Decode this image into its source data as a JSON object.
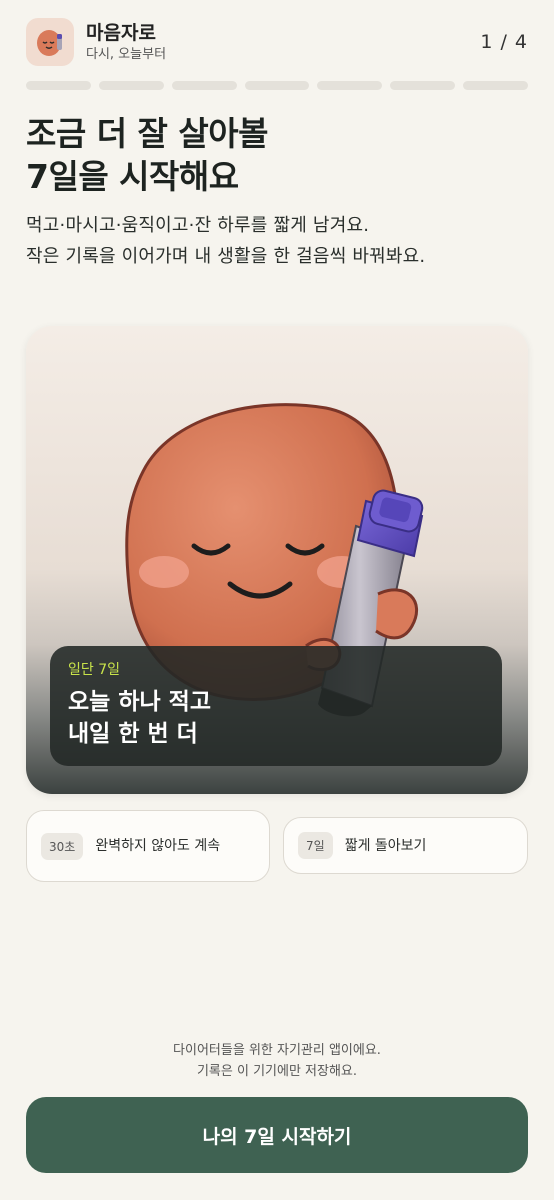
{
  "header": {
    "app_name": "마음자로",
    "app_subtitle": "다시, 오늘부터",
    "step_counter": "1 / 4"
  },
  "progress": {
    "total_steps": 7
  },
  "headline": {
    "line1": "조금 더 잘 살아볼",
    "line2": "7일을 시작해요"
  },
  "intro": {
    "line1": "먹고·마시고·움직이고·잔 하루를 짧게 남겨요.",
    "line2": "작은 기록을 이어가며 내 생활을 한 걸음씩 바꿔봐요."
  },
  "hero": {
    "image_icon": "character-holding-pen-illustration",
    "caption_tag": "일단 7일",
    "caption_line1": "오늘 하나 적고",
    "caption_line2": "내일 한 번 더"
  },
  "chips": [
    {
      "badge": "30초",
      "text": "완벽하지 않아도 계속"
    },
    {
      "badge": "7일",
      "text": "짧게 돌아보기"
    }
  ],
  "footnote": {
    "line1": "다이어터들을 위한 자기관리 앱이에요.",
    "line2": "기록은 이 기기에만 저장해요."
  },
  "cta": {
    "label": "나의 7일 시작하기"
  },
  "colors": {
    "background": "#f6f4ee",
    "primary": "#3f6252",
    "accent_tag": "#c8e34a",
    "character": "#d97a5a"
  }
}
